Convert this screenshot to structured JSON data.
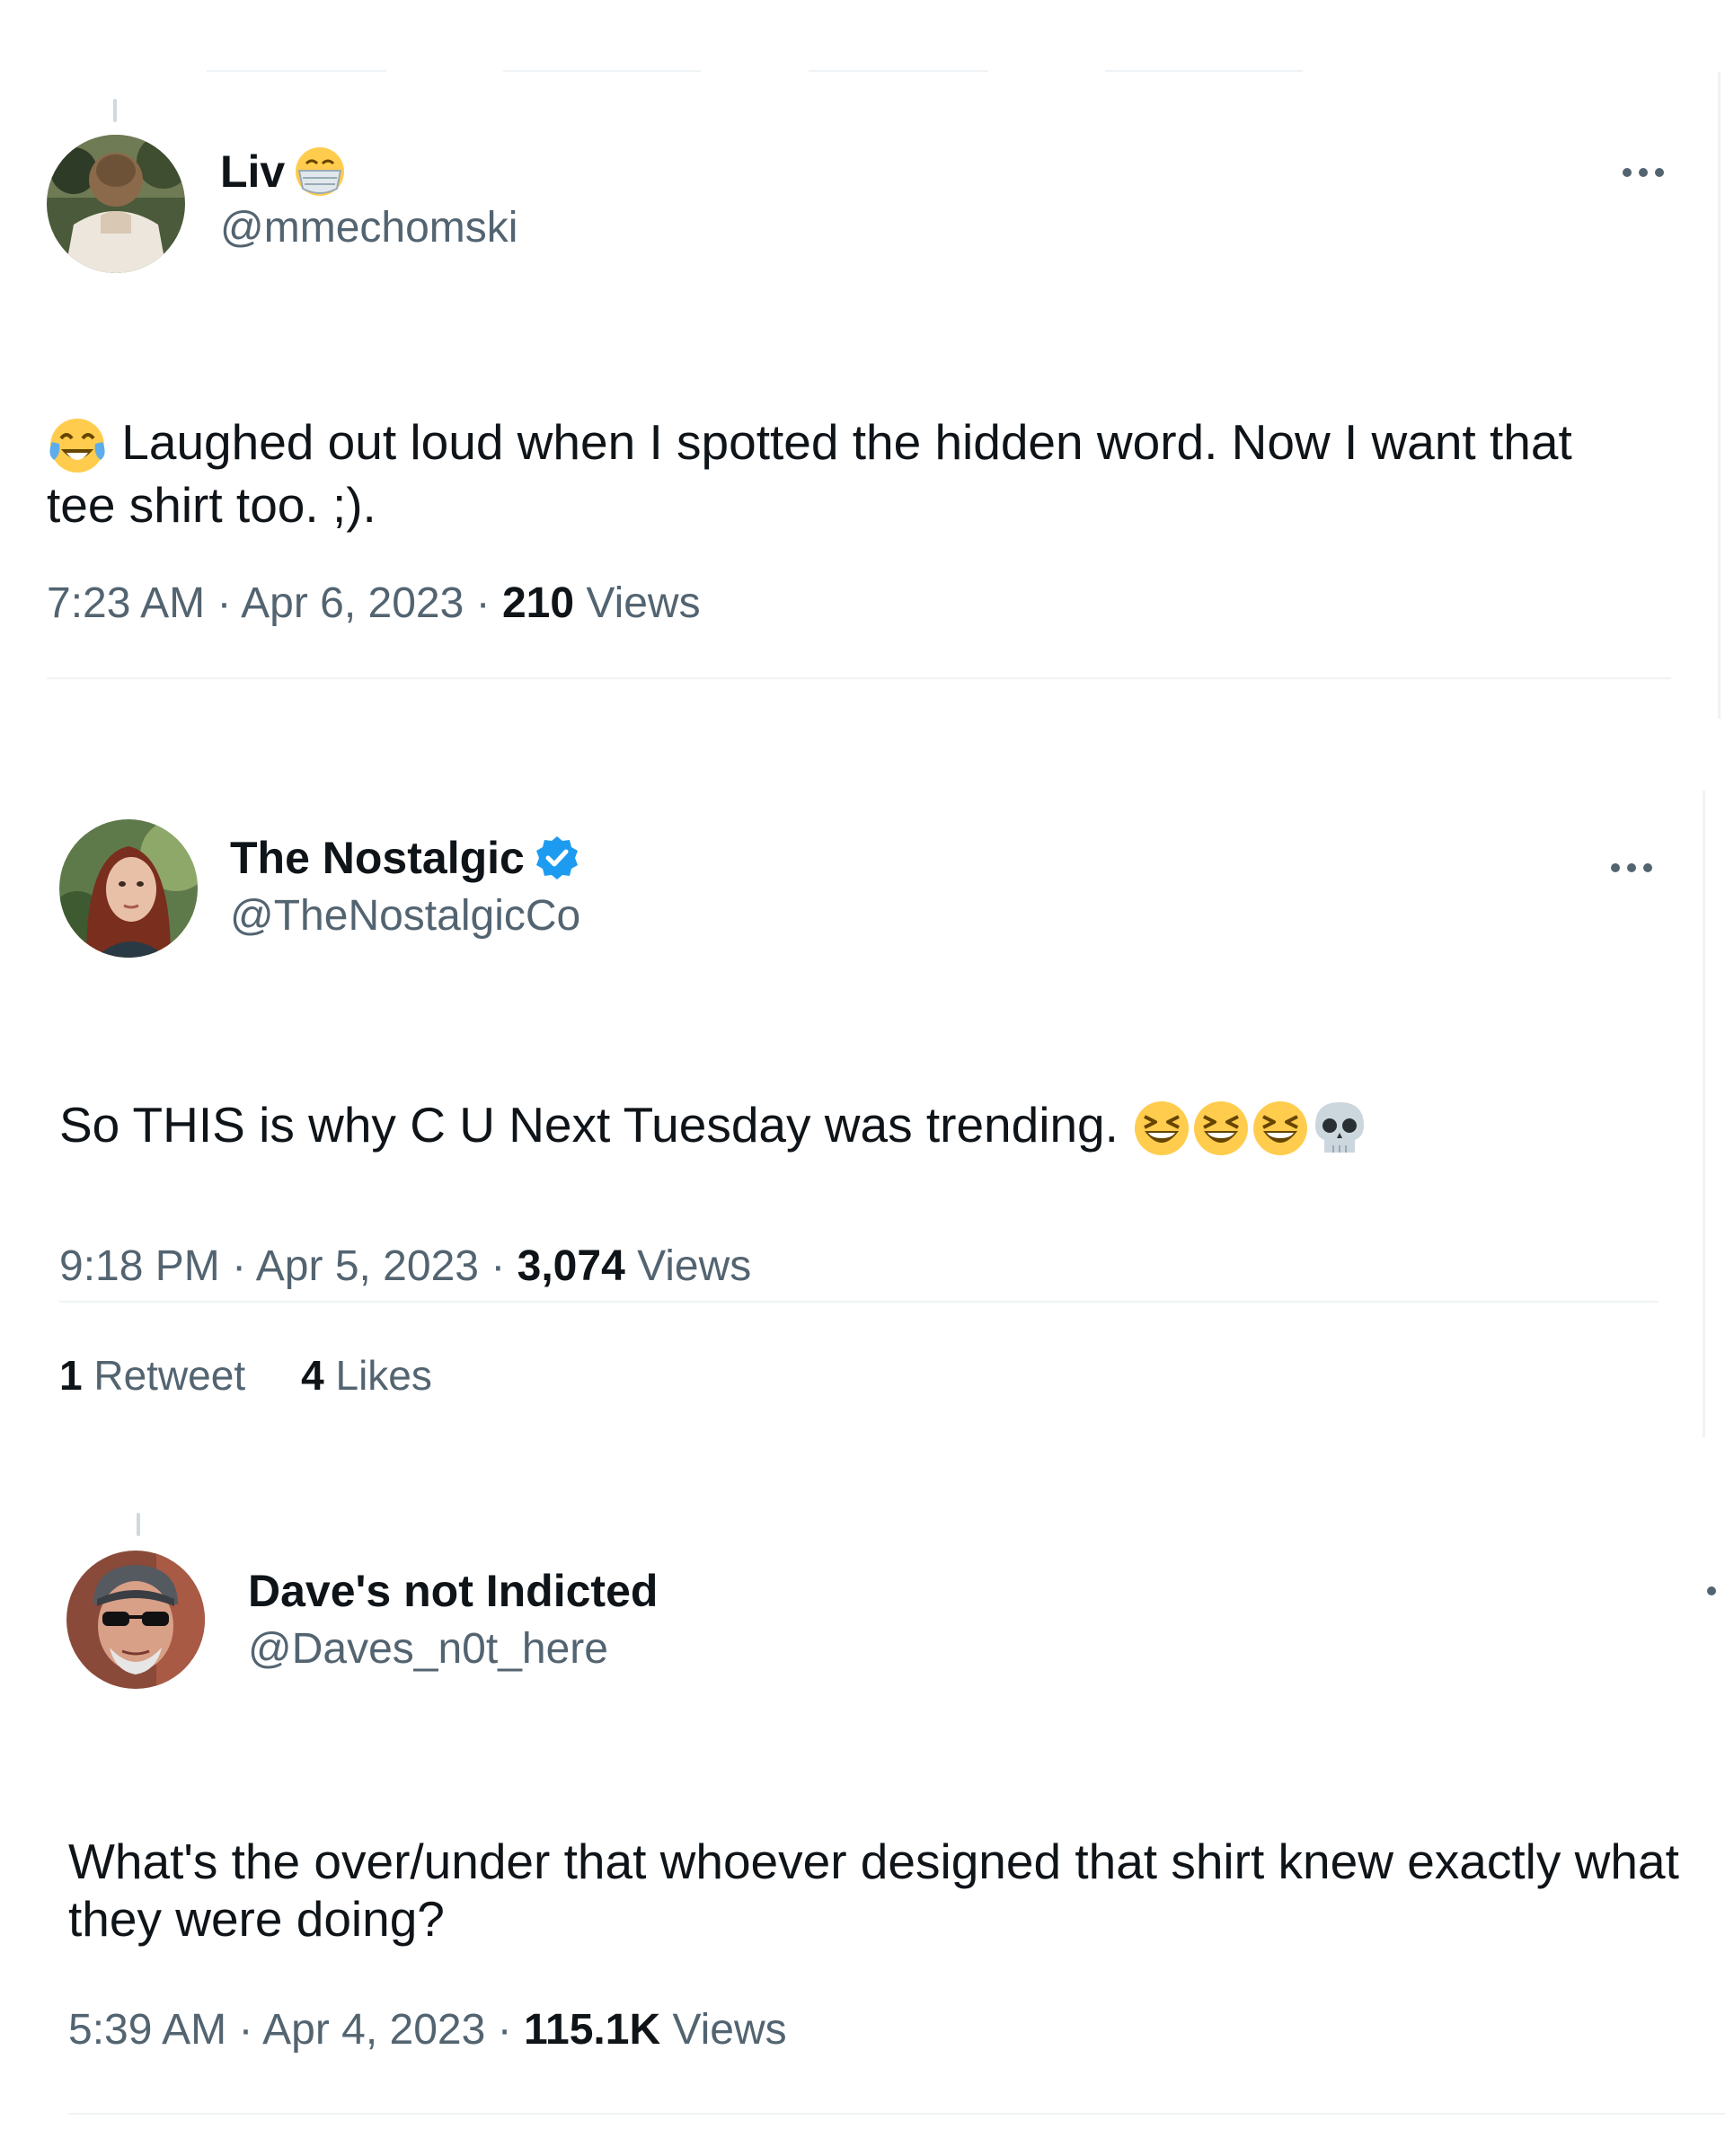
{
  "tweets": [
    {
      "display_name": "Liv",
      "name_emoji": "mask-face-emoji",
      "handle": "@mmechomski",
      "text": "Laughed out loud when I spotted the hidden word.  Now I want that tee shirt too.  ;).",
      "leading_emoji": "tears-of-joy-emoji",
      "time": "7:23 AM",
      "date": "Apr 6, 2023",
      "views_count": "210",
      "views_label": "Views"
    },
    {
      "display_name": "The Nostalgic",
      "name_emoji": "verified-badge-icon",
      "handle": "@TheNostalgicCo",
      "text": "So THIS is why C U Next Tuesday was trending.",
      "trailing_emojis": [
        "grinning-squinting-emoji",
        "grinning-squinting-emoji",
        "grinning-squinting-emoji",
        "skull-emoji"
      ],
      "time": "9:18 PM",
      "date": "Apr 5, 2023",
      "views_count": "3,074",
      "views_label": "Views",
      "retweets_count": "1",
      "retweets_label": "Retweet",
      "likes_count": "4",
      "likes_label": "Likes"
    },
    {
      "display_name": "Dave's not Indicted",
      "handle": "@Daves_n0t_here",
      "text": "What's the over/under that whoever designed that shirt knew exactly what they were doing?",
      "time": "5:39 AM",
      "date": "Apr 4, 2023",
      "views_count": "115.1K",
      "views_label": "Views"
    }
  ],
  "separator": "·",
  "colors": {
    "text_primary": "#0f1419",
    "text_secondary": "#536471",
    "verified_blue": "#1d9bf0",
    "divider": "#eff3f4",
    "emoji_yellow": "#ffcc4d"
  }
}
